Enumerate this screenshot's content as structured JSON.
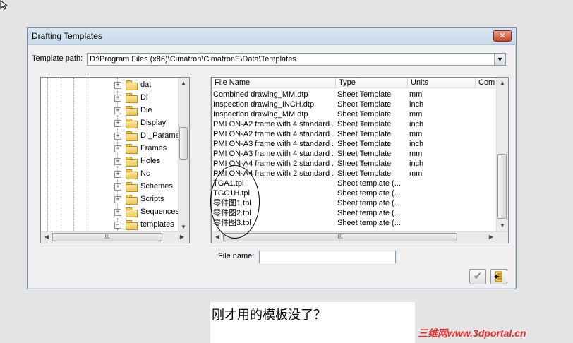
{
  "dialog": {
    "title": "Drafting Templates",
    "close_label": "✕",
    "template_path_label": "Template path:",
    "template_path_value": "D:\\Program Files (x86)\\Cimatron\\CimatronE\\Data\\Templates",
    "file_name_label": "File name:",
    "file_name_value": ""
  },
  "tree": {
    "items": [
      {
        "label": "dat"
      },
      {
        "label": "Di"
      },
      {
        "label": "Die"
      },
      {
        "label": "Display"
      },
      {
        "label": "DI_Parameter_"
      },
      {
        "label": "Frames"
      },
      {
        "label": "Holes"
      },
      {
        "label": "Nc"
      },
      {
        "label": "Schemes"
      },
      {
        "label": "Scripts"
      },
      {
        "label": "Sequences"
      },
      {
        "label": "templates",
        "selected": true
      }
    ],
    "expand_glyph": "+",
    "collapse_glyph": "−",
    "scroll_grip": "III"
  },
  "list": {
    "columns": [
      "File Name",
      "Type",
      "Units",
      "Com"
    ],
    "rows": [
      {
        "name": "Combined drawing_MM.dtp",
        "type": "Sheet Template",
        "units": "mm"
      },
      {
        "name": "Inspection drawing_INCH.dtp",
        "type": "Sheet Template",
        "units": "inch"
      },
      {
        "name": "Inspection drawing_MM.dtp",
        "type": "Sheet Template",
        "units": "mm"
      },
      {
        "name": "PMI ON-A2 frame with 4 standard ...",
        "type": "Sheet Template",
        "units": "inch"
      },
      {
        "name": "PMI ON-A2 frame with 4 standard ...",
        "type": "Sheet Template",
        "units": "mm"
      },
      {
        "name": "PMI ON-A3 frame with 4 standard ...",
        "type": "Sheet Template",
        "units": "inch"
      },
      {
        "name": "PMI ON-A3 frame with 4 standard ...",
        "type": "Sheet Template",
        "units": "mm"
      },
      {
        "name": "PMI ON-A4 frame with 2 standard ...",
        "type": "Sheet Template",
        "units": "inch"
      },
      {
        "name": "PMI ON-A4 frame with 2 standard ...",
        "type": "Sheet Template",
        "units": "mm"
      },
      {
        "name": "TGA1.tpl",
        "type": "Sheet template (...",
        "units": ""
      },
      {
        "name": "TGC1H.tpl",
        "type": "Sheet template (...",
        "units": ""
      },
      {
        "name": "零件图1.tpl",
        "type": "Sheet template (...",
        "units": ""
      },
      {
        "name": "零件图2.tpl",
        "type": "Sheet template (...",
        "units": ""
      },
      {
        "name": "零件图3.tpl",
        "type": "Sheet template (...",
        "units": ""
      }
    ],
    "scroll_grip": "III"
  },
  "caption": "刚才用的模板没了？",
  "watermark": "三维网www.3dportal.cn",
  "icons": {
    "cursor": "arrow-cursor-icon",
    "ok": "checkmark-icon",
    "exit": "exit-door-icon"
  },
  "colors": {
    "watermark": "#e43030",
    "title_bar": "#c9d9ea"
  }
}
